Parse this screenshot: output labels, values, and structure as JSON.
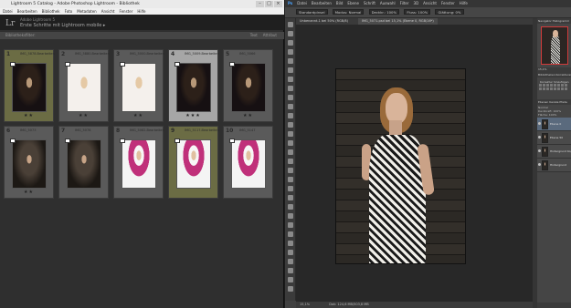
{
  "lightroom": {
    "window_title": "Lightroom 5 Catalog - Adobe Photoshop Lightroom - Bibliothek",
    "menu": [
      "Datei",
      "Bearbeiten",
      "Bibliothek",
      "Foto",
      "Metadaten",
      "Ansicht",
      "Fenster",
      "Hilfe"
    ],
    "identity_logo": "Lr",
    "identity_user": "Adobe Lightroom 5",
    "identity_mobile": "Erste Schritte mit Lightroom mobile ▸",
    "filter_label": "Bibliotheksfilter:",
    "filter_right": [
      "Text",
      "Attribut"
    ],
    "grid": [
      {
        "num": "1",
        "filename": "IMG_5878-Bearbeiten",
        "tone": "dark",
        "bg": "olive",
        "stars": "★★"
      },
      {
        "num": "2",
        "filename": "IMG_5880-Bearbeiten",
        "tone": "white",
        "bg": "dark",
        "stars": "★★"
      },
      {
        "num": "3",
        "filename": "IMG_5000-Bearbeiten",
        "tone": "white",
        "bg": "dark",
        "stars": "★★"
      },
      {
        "num": "4",
        "filename": "IMG_5009-Bearbeiten",
        "tone": "dark",
        "bg": "light",
        "stars": "★★★"
      },
      {
        "num": "5",
        "filename": "IMG_5066",
        "tone": "dark",
        "bg": "dark",
        "stars": "★★"
      },
      {
        "num": "6",
        "filename": "IMG_5073",
        "tone": "dark2",
        "bg": "dark",
        "stars": "★★"
      },
      {
        "num": "7",
        "filename": "IMG_5078",
        "tone": "dark2",
        "bg": "dark",
        "stars": ""
      },
      {
        "num": "8",
        "filename": "IMG_5082-Bearbeiten",
        "tone": "pink",
        "bg": "dark",
        "stars": ""
      },
      {
        "num": "9",
        "filename": "IMG_5117-Bearbeiten",
        "tone": "pink",
        "bg": "olive",
        "stars": ""
      },
      {
        "num": "10",
        "filename": "IMG_5147",
        "tone": "pink",
        "bg": "dark",
        "stars": ""
      }
    ]
  },
  "photoshop": {
    "logo": "Ps",
    "menu": [
      "Datei",
      "Bearbeiten",
      "Bild",
      "Ebene",
      "Schrift",
      "Auswahl",
      "Filter",
      "3D",
      "Ansicht",
      "Fenster",
      "Hilfe"
    ],
    "options": [
      "Standardpinsel",
      "Modus: Normal",
      "Deckkr.: 100%",
      "Fluss: 100%",
      "Glättung: 0%"
    ],
    "tab_inactive": "Unbenannt-1 bei 50% (RGB/8)",
    "tab_active": "IMG_5071.psd bei 15,1% (Ebene 0, RGB/16*)",
    "status_zoom": "15,1%",
    "status_doc": "Dok: 124,6 MB/503,8 MB",
    "panels": {
      "nav_tabs": "Navigator  Histogramm",
      "nav_zoom": "15,1%",
      "adj_tabs": "Bibliotheken  Korrekturen  Stile",
      "adj_title": "Korrektur hinzufügen",
      "layer_tabs": "Ebenen  Kanäle  Pfade",
      "layer_mode": "Normal",
      "layer_opacity": "Deckkraft: 100%",
      "layer_fill": "Fläche: 100%",
      "layers": [
        {
          "name": "Ebene 0",
          "selected": true
        },
        {
          "name": "Ebene 50",
          "selected": false
        },
        {
          "name": "Hintergrund Kopie",
          "selected": false
        },
        {
          "name": "Hintergrund",
          "selected": false
        }
      ]
    }
  }
}
